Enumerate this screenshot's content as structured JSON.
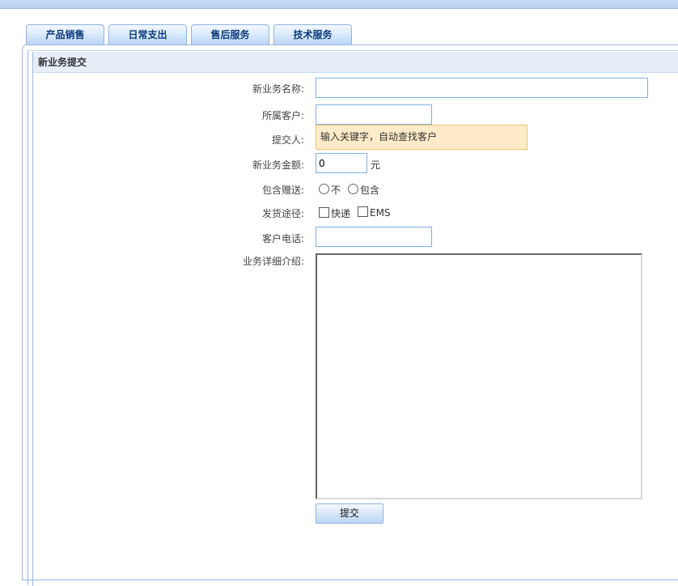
{
  "tabs": [
    {
      "label": "产品销售"
    },
    {
      "label": "日常支出"
    },
    {
      "label": "售后服务"
    },
    {
      "label": "技术服务"
    }
  ],
  "section": {
    "title": "新业务提交"
  },
  "form": {
    "name_label": "新业务名称:",
    "name_value": "",
    "customer_label": "所属客户:",
    "customer_value": "",
    "submitter_label": "提交人:",
    "submitter_hint": "输入关键字，自动查找客户",
    "amount_label": "新业务金额:",
    "amount_value": "0",
    "amount_unit": "元",
    "gift_label": "包含赠送:",
    "gift_options": [
      "不",
      "包含"
    ],
    "shipping_label": "发货途径:",
    "shipping_options": [
      "快递",
      "EMS"
    ],
    "phone_label": "客户电话:",
    "phone_value": "",
    "detail_label": "业务详细介绍:",
    "detail_value": "",
    "submit_label": "提交"
  },
  "colors": {
    "accent": "#9ab8e4",
    "tab_text": "#0b3a7a",
    "hint_bg": "#ffebc8",
    "hint_border": "#f0c070",
    "input_border": "#7fb1e4"
  }
}
